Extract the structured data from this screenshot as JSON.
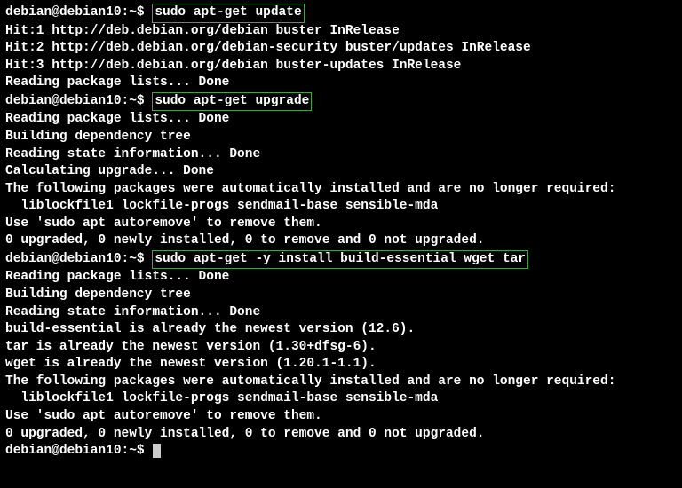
{
  "prompt": "debian@debian10:~$ ",
  "cmd1": "sudo apt-get update",
  "out1_l1": "Hit:1 http://deb.debian.org/debian buster InRelease",
  "out1_l2": "Hit:2 http://deb.debian.org/debian-security buster/updates InRelease",
  "out1_l3": "Hit:3 http://deb.debian.org/debian buster-updates InRelease",
  "out1_l4": "Reading package lists... Done",
  "cmd2": "sudo apt-get upgrade",
  "out2_l1": "Reading package lists... Done",
  "out2_l2": "Building dependency tree",
  "out2_l3": "Reading state information... Done",
  "out2_l4": "Calculating upgrade... Done",
  "out2_l5": "The following packages were automatically installed and are no longer required:",
  "out2_l6": "  liblockfile1 lockfile-progs sendmail-base sensible-mda",
  "out2_l7": "Use 'sudo apt autoremove' to remove them.",
  "out2_l8": "0 upgraded, 0 newly installed, 0 to remove and 0 not upgraded.",
  "cmd3": "sudo apt-get -y install build-essential wget tar",
  "out3_l1": "Reading package lists... Done",
  "out3_l2": "Building dependency tree",
  "out3_l3": "Reading state information... Done",
  "out3_l4": "build-essential is already the newest version (12.6).",
  "out3_l5": "tar is already the newest version (1.30+dfsg-6).",
  "out3_l6": "wget is already the newest version (1.20.1-1.1).",
  "out3_l7": "The following packages were automatically installed and are no longer required:",
  "out3_l8": "  liblockfile1 lockfile-progs sendmail-base sensible-mda",
  "out3_l9": "Use 'sudo apt autoremove' to remove them.",
  "out3_l10": "0 upgraded, 0 newly installed, 0 to remove and 0 not upgraded."
}
